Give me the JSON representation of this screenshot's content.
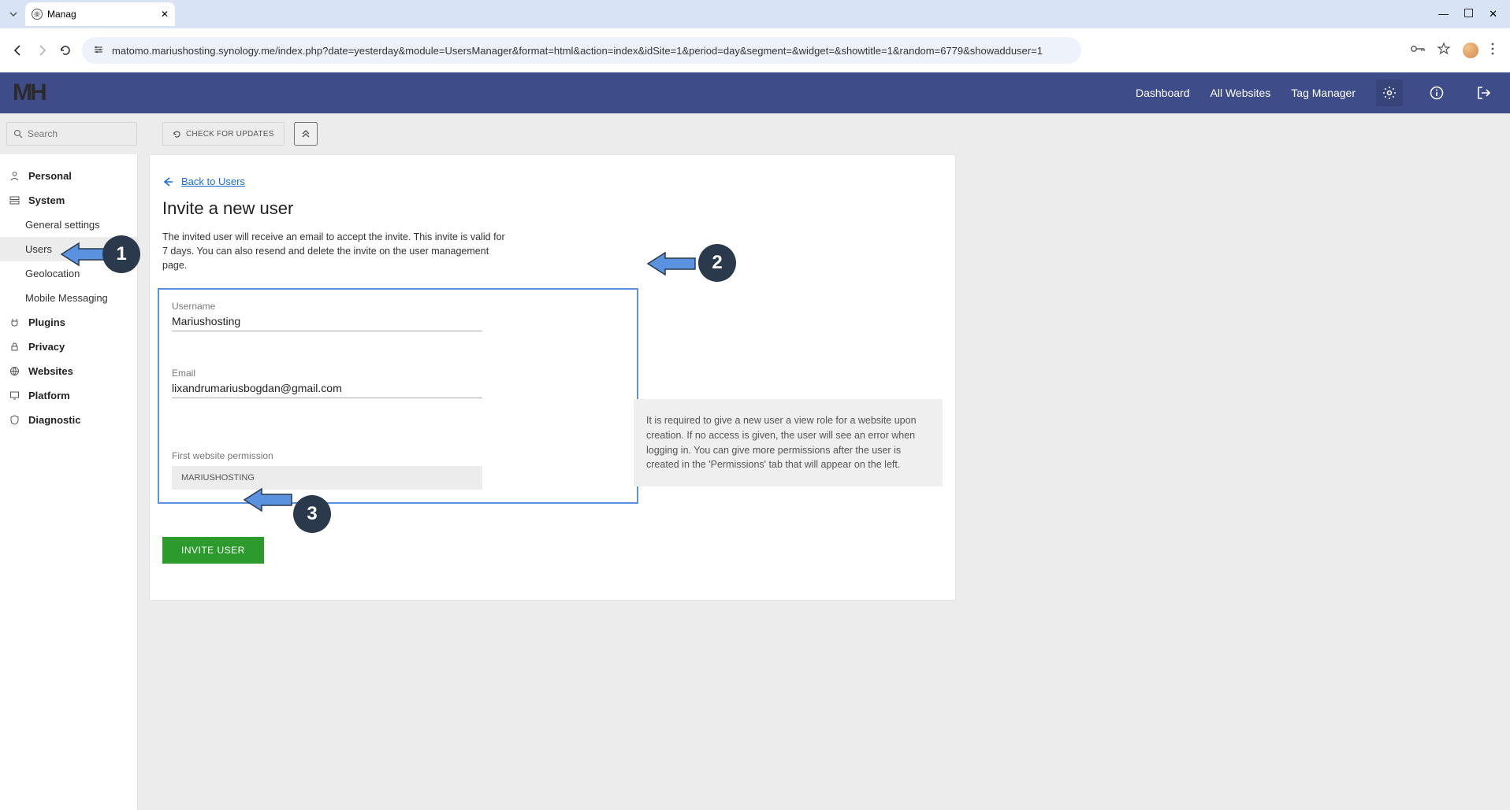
{
  "browser": {
    "tab_title": "Manag",
    "url": "matomo.mariushosting.synology.me/index.php?date=yesterday&module=UsersManager&format=html&action=index&idSite=1&period=day&segment=&widget=&showtitle=1&random=6779&showadduser=1"
  },
  "header": {
    "nav": {
      "dashboard": "Dashboard",
      "all_websites": "All Websites",
      "tag_manager": "Tag Manager"
    }
  },
  "toolbar": {
    "search_placeholder": "Search",
    "check_updates": "CHECK FOR UPDATES"
  },
  "sidebar": {
    "personal": "Personal",
    "system": "System",
    "general_settings": "General settings",
    "users": "Users",
    "geolocation": "Geolocation",
    "mobile_messaging": "Mobile Messaging",
    "plugins": "Plugins",
    "privacy": "Privacy",
    "websites": "Websites",
    "platform": "Platform",
    "diagnostic": "Diagnostic"
  },
  "main": {
    "back_link": "Back to Users",
    "title": "Invite a new user",
    "description": "The invited user will receive an email to accept the invite. This invite is valid for 7 days. You can also resend and delete the invite on the user management page.",
    "form": {
      "username_label": "Username",
      "username_value": "Mariushosting",
      "email_label": "Email",
      "email_value": "lixandrumariusbogdan@gmail.com",
      "permission_label": "First website permission",
      "permission_value": "MARIUSHOSTING"
    },
    "info_panel": "It is required to give a new user a view role for a website upon creation. If no access is given, the user will see an error when logging in. You can give more permissions after the user is created in the 'Permissions' tab that will appear on the left.",
    "invite_button": "INVITE USER"
  },
  "annotations": {
    "one": "1",
    "two": "2",
    "three": "3"
  }
}
